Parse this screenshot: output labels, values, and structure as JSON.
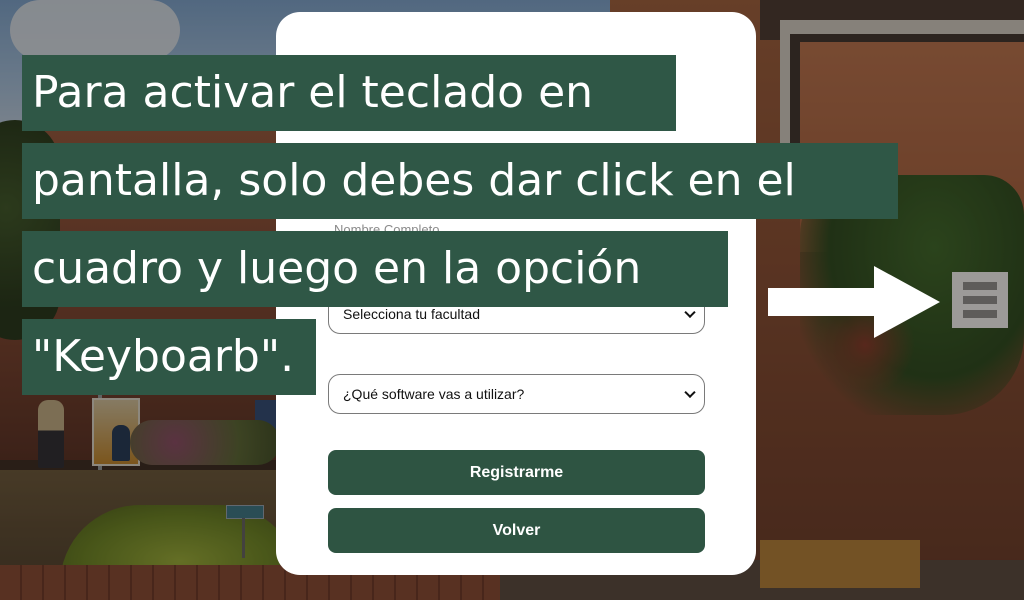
{
  "overlay": {
    "lines": [
      "Para activar el teclado en",
      "pantalla, solo debes dar click en el",
      "cuadro y luego en la opción",
      "\"Keyboarb\"."
    ]
  },
  "form": {
    "name_label": "Nombre Completo",
    "faculty_select": "Selecciona tu facultad",
    "software_select": "¿Qué software vas a utilizar?",
    "register_button": "Registrarme",
    "back_button": "Volver"
  },
  "colors": {
    "accent": "#2e5442",
    "overlay_bg": "#2f5746",
    "card_bg": "#ffffff",
    "menu_bg": "#9c9a98"
  },
  "icons": {
    "menu": "hamburger-menu-icon",
    "arrow": "arrow-right-icon"
  }
}
